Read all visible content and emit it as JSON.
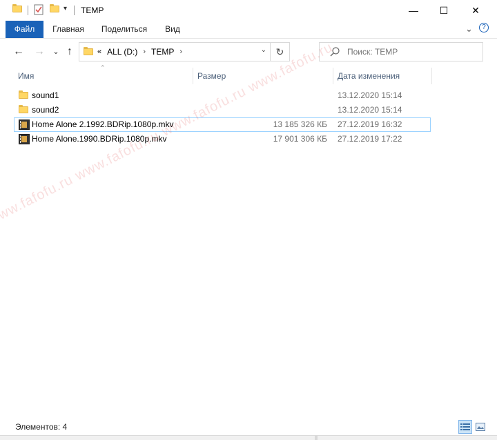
{
  "window": {
    "title": "TEMP",
    "minimize_glyph": "—",
    "maximize_glyph": "☐",
    "close_glyph": "✕"
  },
  "quick_access": {
    "dropdown_glyph": "▾"
  },
  "ribbon": {
    "tabs": [
      "Файл",
      "Главная",
      "Поделиться",
      "Вид"
    ],
    "expand_glyph": "⌄",
    "help_glyph": "?"
  },
  "nav": {
    "back_glyph": "←",
    "forward_glyph": "→",
    "recent_glyph": "⌄",
    "up_glyph": "↑"
  },
  "address": {
    "overflow_glyph": "«",
    "items": [
      "ALL (D:)",
      "TEMP"
    ],
    "sep_glyph": "›",
    "dropdown_glyph": "⌄",
    "refresh_glyph": "↻"
  },
  "search": {
    "placeholder": "Поиск: TEMP"
  },
  "columns": {
    "sort_glyph": "⌃",
    "name": "Имя",
    "size": "Размер",
    "date": "Дата изменения"
  },
  "files": [
    {
      "name": "sound1",
      "size": "",
      "date": "13.12.2020 15:14",
      "type": "folder-icon"
    },
    {
      "name": "sound2",
      "size": "",
      "date": "13.12.2020 15:14",
      "type": "folder-icon"
    },
    {
      "name": "Home Alone 2.1992.BDRip.1080p.mkv",
      "size": "13 185 326 КБ",
      "date": "27.12.2019 16:32",
      "type": "video-file-icon"
    },
    {
      "name": "Home Alone.1990.BDRip.1080p.mkv",
      "size": "17 901 306 КБ",
      "date": "27.12.2019 17:22",
      "type": "video-file-icon"
    }
  ],
  "status": {
    "item_count": "Элементов: 4"
  },
  "watermark": {
    "text": "www.fafofu.ru www.fafofu.ru www.fafofu.ru www.fafofu.ru"
  },
  "colors": {
    "file_tab": "#1a62b8",
    "selection_border": "#99d1ff",
    "header_text": "#4c607a",
    "folder": "#ffd765"
  }
}
